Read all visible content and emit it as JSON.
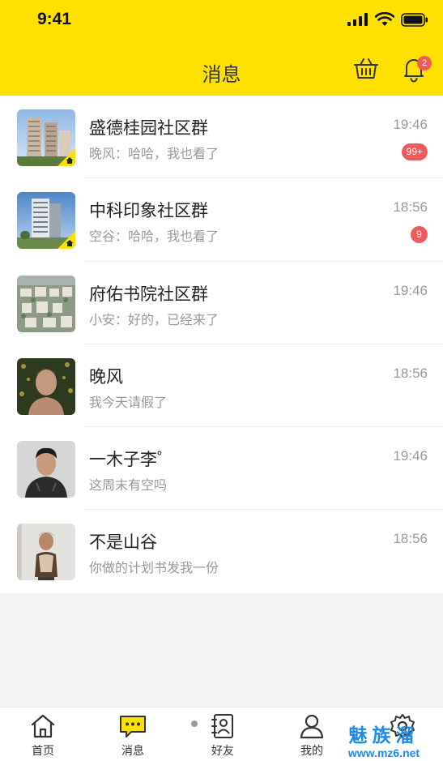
{
  "status_bar": {
    "time": "9:41"
  },
  "header": {
    "title": "消息",
    "notification_count": "2"
  },
  "conversations": [
    {
      "name": "盛德桂园社区群",
      "preview": "晚风：哈哈，我也看了",
      "time": "19:46",
      "unread": "99+",
      "avatar": "building-photo",
      "community": true
    },
    {
      "name": "中科印象社区群",
      "preview": "空谷：哈哈，我也看了",
      "time": "18:56",
      "unread": "9",
      "avatar": "building-photo",
      "community": true
    },
    {
      "name": "府佑书院社区群",
      "preview": "小安：好的，已经来了",
      "time": "19:46",
      "unread": "",
      "avatar": "aerial-photo",
      "community": false
    },
    {
      "name": "晚风",
      "preview": "我今天请假了",
      "time": "18:56",
      "unread": "",
      "avatar": "person-photo",
      "community": false
    },
    {
      "name": "一木子李゜",
      "preview": "这周末有空吗",
      "time": "19:46",
      "unread": "",
      "avatar": "person-photo",
      "community": false
    },
    {
      "name": "不是山谷",
      "preview": "你做的计划书发我一份",
      "time": "18:56",
      "unread": "",
      "avatar": "person-photo",
      "community": false
    }
  ],
  "tabs": [
    {
      "label": "首页",
      "icon": "home-icon"
    },
    {
      "label": "消息",
      "icon": "chat-icon",
      "active": true
    },
    {
      "label": "好友",
      "icon": "contacts-icon"
    },
    {
      "label": "我的",
      "icon": "profile-icon"
    },
    {
      "label": "",
      "icon": "settings-icon"
    }
  ],
  "watermark": {
    "line1": "魅族溜",
    "line2": "www.mz6.net"
  },
  "colors": {
    "brand_yellow": "#ffe100",
    "badge_red": "#f05a5a",
    "watermark_blue": "#1f8ae8"
  }
}
